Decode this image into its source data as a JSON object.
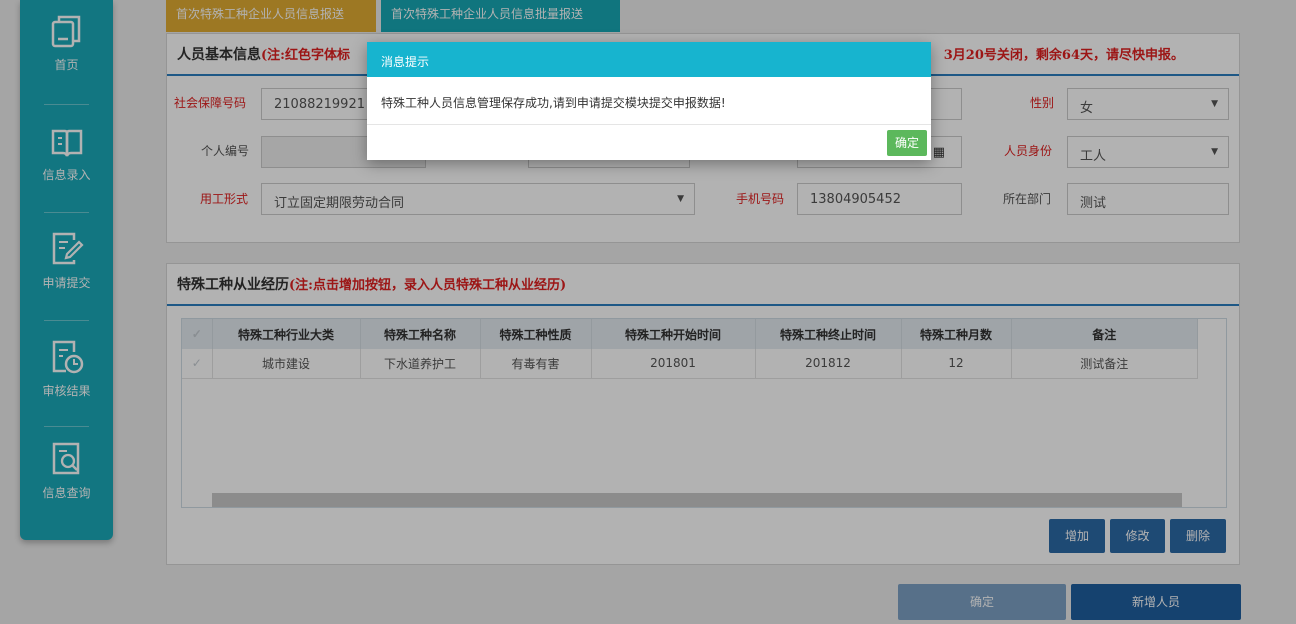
{
  "sidebar": {
    "items": [
      {
        "label": "首页",
        "icon": "home-icon"
      },
      {
        "label": "信息录入",
        "icon": "book-icon"
      },
      {
        "label": "申请提交",
        "icon": "edit-icon"
      },
      {
        "label": "审核结果",
        "icon": "clock-doc-icon"
      },
      {
        "label": "信息查询",
        "icon": "search-doc-icon"
      }
    ]
  },
  "tabs": [
    {
      "label": "首次特殊工种企业人员信息报送"
    },
    {
      "label": "首次特殊工种企业人员信息批量报送"
    }
  ],
  "basic": {
    "title": "人员基本信息",
    "note": "(注:红色字体标",
    "deadline": "3月20号关闭，剩余64天，请尽快申报。",
    "ssn_label": "社会保障号码",
    "ssn_value": "21088219921",
    "gender_label": "性别",
    "gender_value": "女",
    "personal_no_label": "个人编号",
    "identity_label": "人员身份",
    "identity_value": "工人",
    "employment_label": "用工形式",
    "employment_value": "订立固定期限劳动合同",
    "phone_label": "手机号码",
    "phone_value": "13804905452",
    "dept_label": "所在部门",
    "dept_value": "测试"
  },
  "experience": {
    "title": "特殊工种从业经历",
    "note": "(注:点击增加按钮，录入人员特殊工种从业经历)",
    "columns": [
      "特殊工种行业大类",
      "特殊工种名称",
      "特殊工种性质",
      "特殊工种开始时间",
      "特殊工种终止时间",
      "特殊工种月数",
      "备注"
    ],
    "rows": [
      [
        "城市建设",
        "下水道养护工",
        "有毒有害",
        "201801",
        "201812",
        "12",
        "测试备注"
      ]
    ],
    "add_label": "增加",
    "edit_label": "修改",
    "delete_label": "删除"
  },
  "footer": {
    "confirm_label": "确定",
    "new_person_label": "新增人员"
  },
  "modal": {
    "title": "消息提示",
    "message": "特殊工种人员信息管理保存成功,请到申请提交模块提交申报数据!",
    "ok_label": "确定"
  },
  "colors": {
    "sidebar": "#1ba9b9",
    "accent_blue": "#2c6aa7",
    "required_red": "#e02020",
    "modal_header": "#17b4cf",
    "ok_green": "#5cb85c"
  }
}
